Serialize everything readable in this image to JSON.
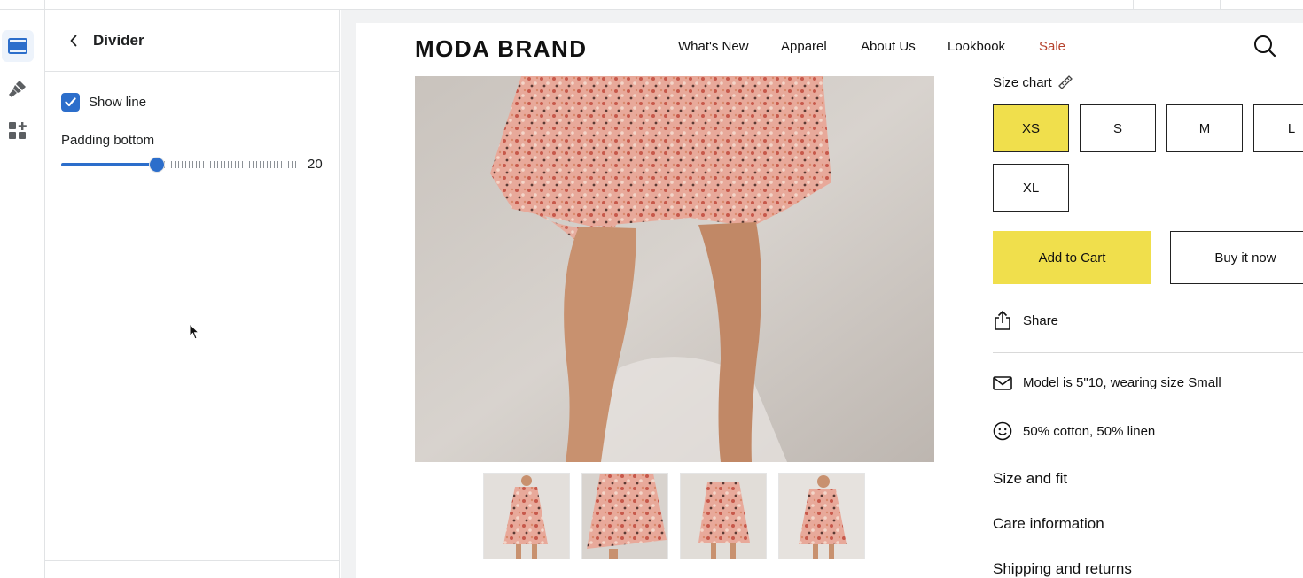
{
  "editor": {
    "panel_title": "Divider",
    "show_line": {
      "label": "Show line",
      "checked": true
    },
    "padding_bottom": {
      "label": "Padding bottom",
      "value": "20"
    }
  },
  "rail": {
    "icons": [
      "sections-icon",
      "theme-brush-icon",
      "apps-add-icon"
    ]
  },
  "store": {
    "brand": "MODA BRAND",
    "nav": [
      "What's New",
      "Apparel",
      "About Us",
      "Lookbook",
      "Sale"
    ],
    "size_chart_label": "Size chart",
    "sizes": [
      "XS",
      "S",
      "M",
      "L",
      "XL"
    ],
    "selected_size": "XS",
    "add_to_cart": "Add to Cart",
    "buy_now": "Buy it now",
    "share": "Share",
    "info": [
      "Model is 5\"10, wearing size Small",
      "50% cotton, 50% linen"
    ],
    "accordions": [
      "Size and fit",
      "Care information",
      "Shipping and returns"
    ],
    "colors": {
      "accent": "#f0df4c",
      "sale": "#b5402b",
      "editor_blue": "#2c6ecb"
    }
  }
}
